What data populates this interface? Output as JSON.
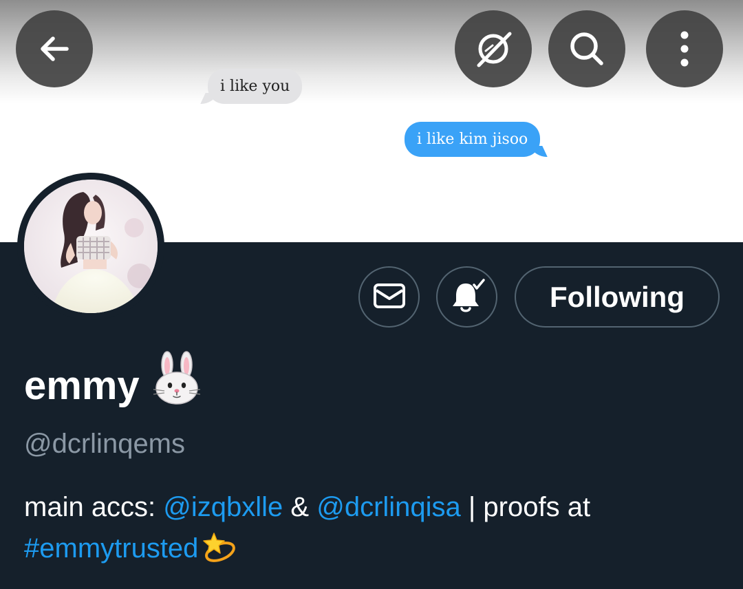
{
  "banner": {
    "received_message": "i like you",
    "sent_message": "i like kim jisoo"
  },
  "nav": {
    "back_icon": "arrow-left-icon",
    "grok_icon": "slashed-circle-icon",
    "search_icon": "search-icon",
    "more_icon": "vertical-dots-icon"
  },
  "actions": {
    "message_icon": "envelope-icon",
    "notifications_icon": "bell-check-icon",
    "following_label": "Following"
  },
  "profile": {
    "display_name": "emmy",
    "display_name_emoji": "rabbit-face-emoji",
    "handle": "@dcrlinqems",
    "bio": {
      "prefix": "main accs: ",
      "mention_1": "@izqbxlle",
      "separator_1": " & ",
      "mention_2": "@dcrlinqisa",
      "separator_2": " | proofs at ",
      "hashtag": "#emmytrusted",
      "trailing_emoji": "dizzy-star-emoji"
    }
  },
  "colors": {
    "background": "#15202b",
    "link": "#1d9bf0",
    "muted_text": "#8b98a5",
    "button_border": "#536471",
    "sent_bubble": "#3aa2f7",
    "received_bubble": "#e3e3e5"
  }
}
